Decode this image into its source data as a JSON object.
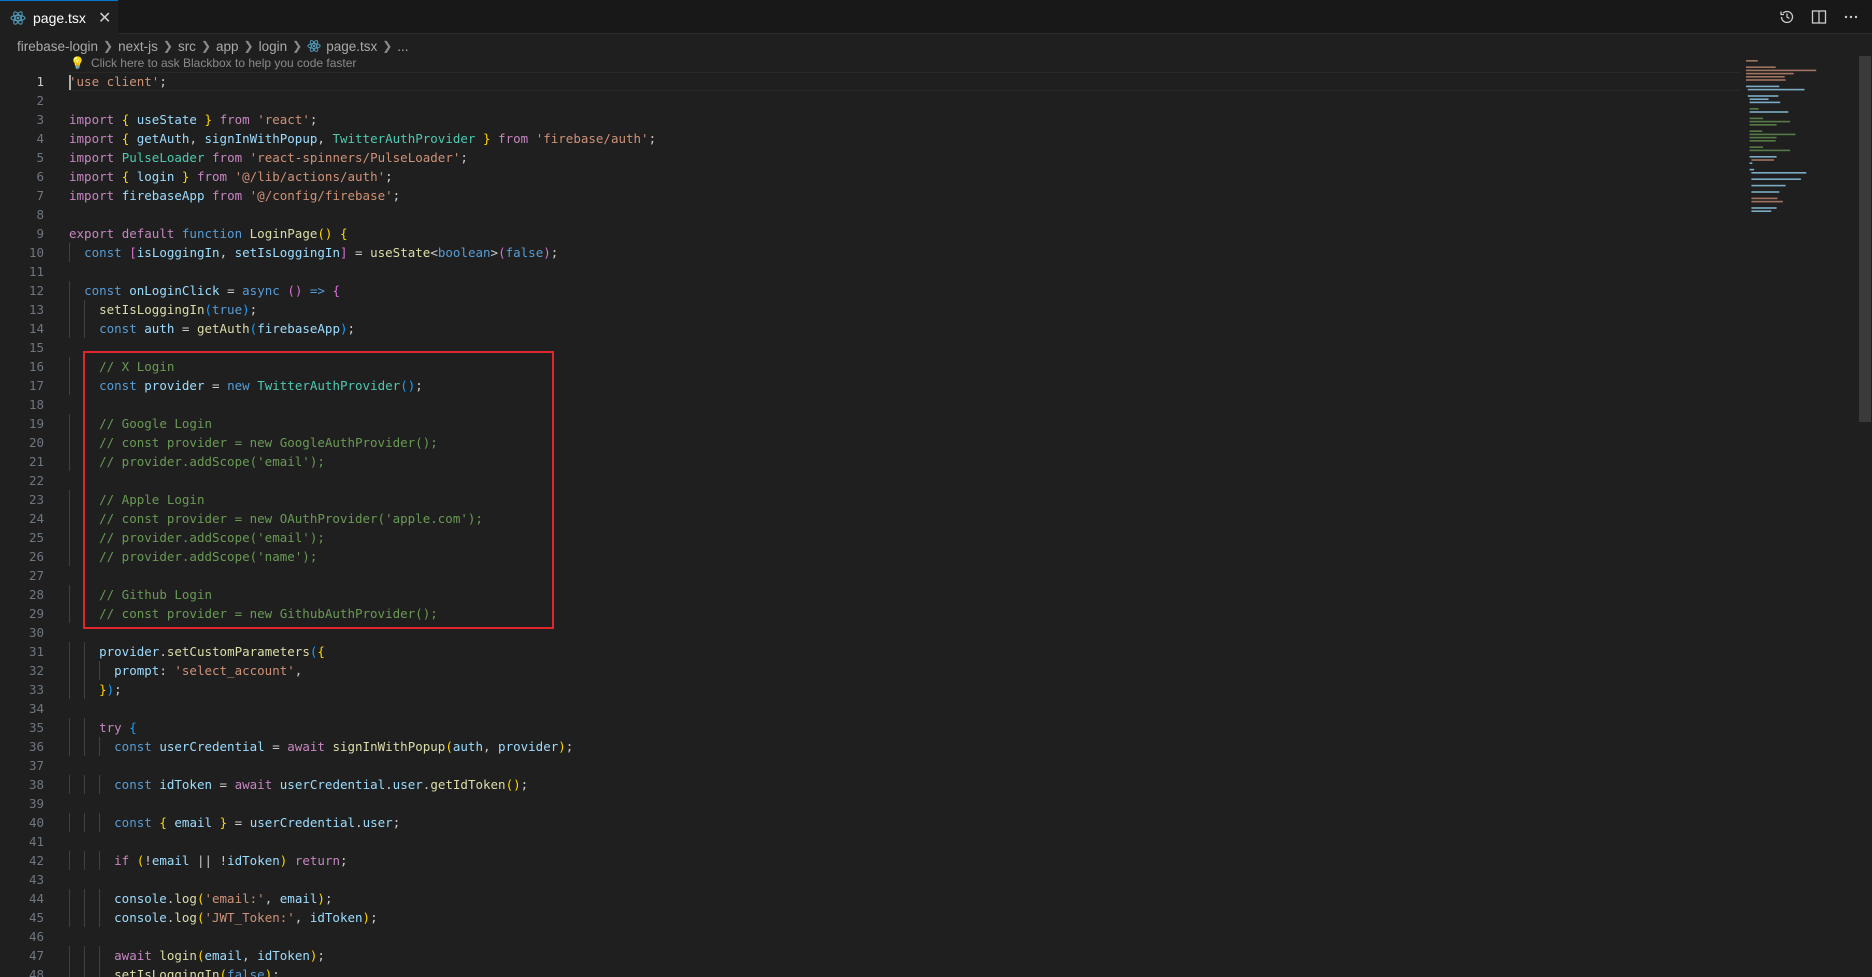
{
  "tab": {
    "label": "page.tsx",
    "close": "✕"
  },
  "breadcrumb": [
    "firebase-login",
    "next-js",
    "src",
    "app",
    "login",
    "page.tsx",
    "..."
  ],
  "hint": "Click here to ask Blackbox to help you code faster",
  "colors": {
    "keyword": "#569cd6",
    "control": "#c586c0",
    "string": "#ce9178",
    "function": "#dcdcaa",
    "variable": "#9cdcfe",
    "comment": "#6a9955",
    "type": "#4ec9b0",
    "highlight_box": "#e0262b",
    "accent": "#0078d4"
  },
  "line_numbers": [
    "1",
    "2",
    "3",
    "4",
    "5",
    "6",
    "7",
    "8",
    "9",
    "10",
    "11",
    "12",
    "13",
    "14",
    "15",
    "16",
    "17",
    "18",
    "19",
    "20",
    "21",
    "22",
    "23",
    "24",
    "25",
    "26",
    "27",
    "28",
    "29",
    "30",
    "31",
    "32",
    "33",
    "34",
    "35",
    "36",
    "37",
    "38",
    "39",
    "40",
    "41",
    "42",
    "43",
    "44",
    "45",
    "46",
    "47",
    "48"
  ],
  "code_lines": [
    "'use client';",
    "",
    "import { useState } from 'react';",
    "import { getAuth, signInWithPopup, TwitterAuthProvider } from 'firebase/auth';",
    "import PulseLoader from 'react-spinners/PulseLoader';",
    "import { login } from '@/lib/actions/auth';",
    "import firebaseApp from '@/config/firebase';",
    "",
    "export default function LoginPage() {",
    "  const [isLoggingIn, setIsLoggingIn] = useState<boolean>(false);",
    "",
    "  const onLoginClick = async () => {",
    "    setIsLoggingIn(true);",
    "    const auth = getAuth(firebaseApp);",
    "",
    "    // X Login",
    "    const provider = new TwitterAuthProvider();",
    "",
    "    // Google Login",
    "    // const provider = new GoogleAuthProvider();",
    "    // provider.addScope('email');",
    "",
    "    // Apple Login",
    "    // const provider = new OAuthProvider('apple.com');",
    "    // provider.addScope('email');",
    "    // provider.addScope('name');",
    "",
    "    // Github Login",
    "    // const provider = new GithubAuthProvider();",
    "",
    "    provider.setCustomParameters({",
    "      prompt: 'select_account',",
    "    });",
    "",
    "    try {",
    "      const userCredential = await signInWithPopup(auth, provider);",
    "",
    "      const idToken = await userCredential.user.getIdToken();",
    "",
    "      const { email } = userCredential.user;",
    "",
    "      if (!email || !idToken) return;",
    "",
    "      console.log('email:', email);",
    "      console.log('JWT_Token:', idToken);",
    "",
    "      await login(email, idToken);",
    "      setIsLoggingIn(false);"
  ],
  "icons": [
    "react-file-icon",
    "close-icon",
    "history-icon",
    "split-editor-icon",
    "more-actions-icon",
    "lightbulb-icon",
    "chevron-right-icon"
  ]
}
